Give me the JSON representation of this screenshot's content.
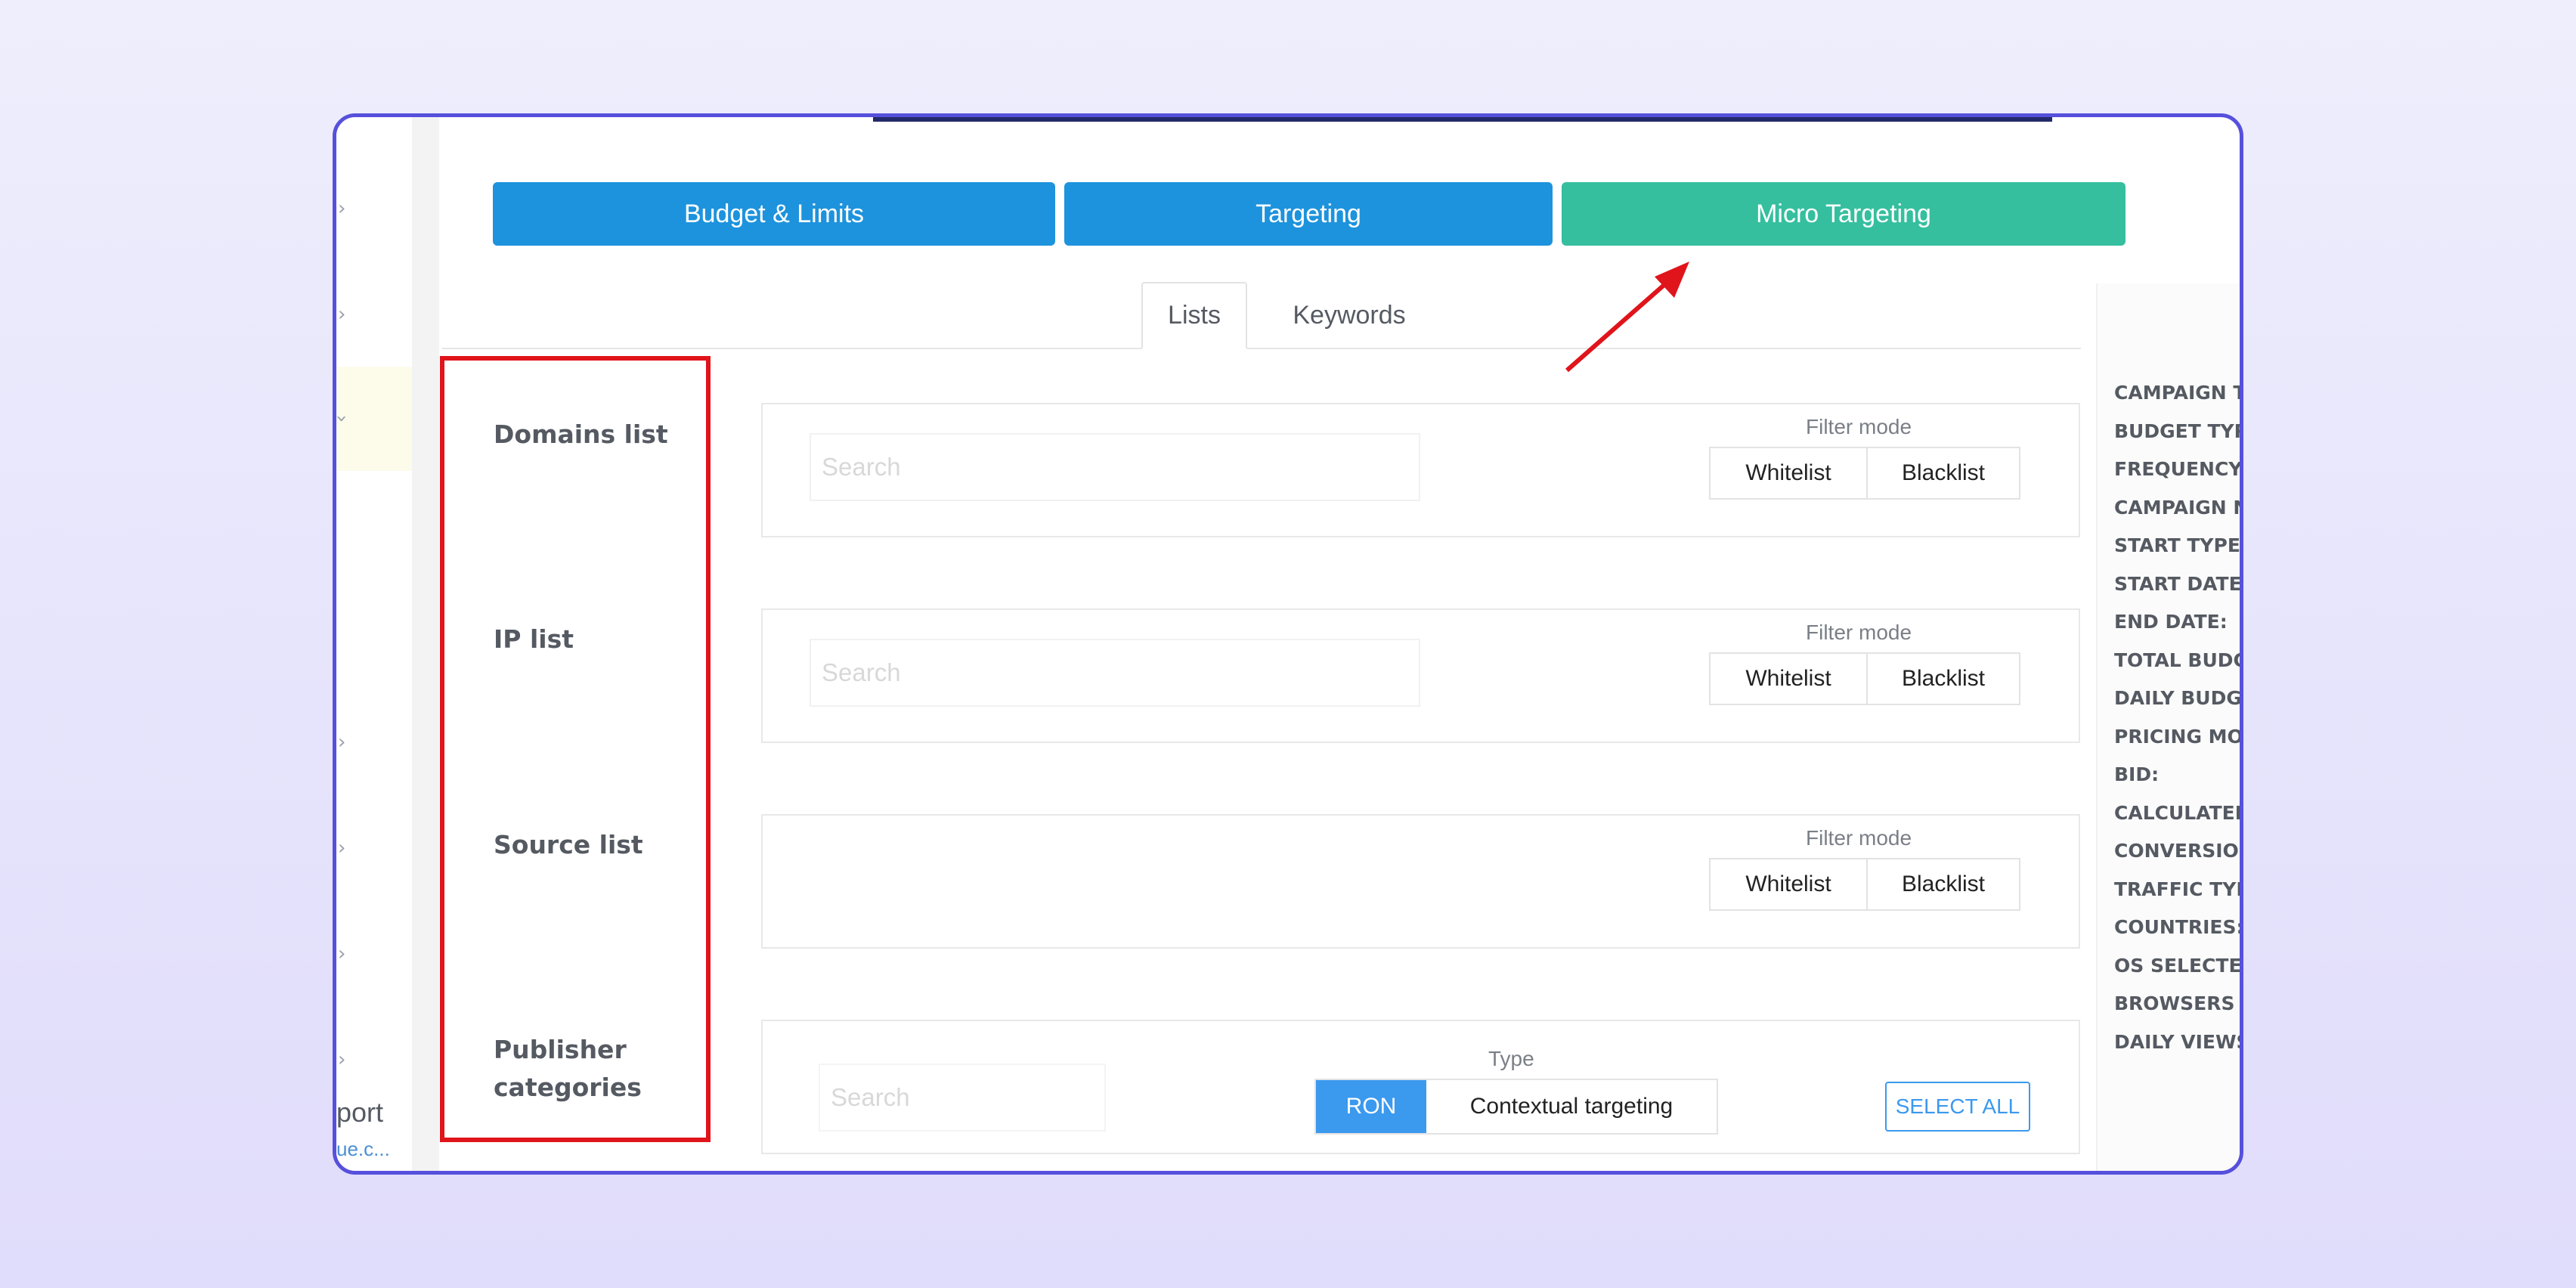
{
  "top_tabs": [
    {
      "label": "Budget & Limits",
      "color": "#1d93dd"
    },
    {
      "label": "Targeting",
      "color": "#1d93dd"
    },
    {
      "label": "Micro Targeting",
      "color": "#35bf9f"
    }
  ],
  "sub_tabs": [
    {
      "label": "Lists",
      "active": true
    },
    {
      "label": "Keywords",
      "active": false
    }
  ],
  "rows": {
    "domains": {
      "label": "Domains list",
      "search_placeholder": "Search"
    },
    "ip": {
      "label": "IP list",
      "search_placeholder": "Search"
    },
    "source": {
      "label": "Source list"
    },
    "publisher": {
      "label_line1": "Publisher",
      "label_line2": "categories",
      "search_placeholder": "Search"
    }
  },
  "filter_mode": {
    "label": "Filter mode",
    "whitelist": "Whitelist",
    "blacklist": "Blacklist"
  },
  "publisher_type": {
    "label": "Type",
    "ron": "RON",
    "contextual": "Contextual targeting",
    "select_all": "SELECT ALL"
  },
  "sidebar": {
    "support_text": "port",
    "support_url": "ue.c..."
  },
  "summary_items": [
    "CAMPAIGN T",
    "BUDGET TYPE",
    "FREQUENCY C",
    "CAMPAIGN N",
    "START TYPE:",
    "START DATE:",
    "END DATE:",
    "TOTAL BUDG",
    "DAILY BUDGE",
    "PRICING MOD",
    "BID:",
    "CALCULATED",
    "CONVERSION",
    "TRAFFIC TYPE",
    "COUNTRIES:",
    "OS SELECTED",
    "BROWSERS S",
    "DAILY VIEWS"
  ],
  "colors": {
    "frame": "#5650dc",
    "highlight": "#e0141b",
    "primary": "#1d93dd",
    "accent": "#35bf9f",
    "selected": "#3b99ee"
  }
}
